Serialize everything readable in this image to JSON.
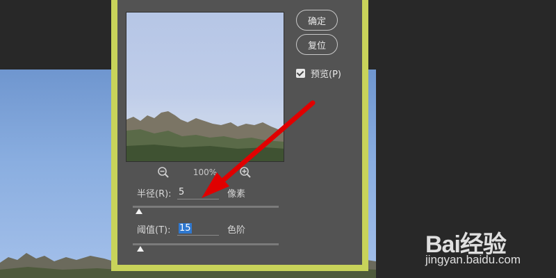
{
  "dialog": {
    "buttons": {
      "ok_label": "确定",
      "reset_label": "复位"
    },
    "preview_checkbox": {
      "label": "预览(P)",
      "checked": true
    },
    "zoom": {
      "level": "100%",
      "zoom_out_icon": "zoom-out-icon",
      "zoom_in_icon": "zoom-in-icon"
    },
    "radius": {
      "label": "半径(R):",
      "value": "5",
      "unit": "像素",
      "slider_fraction": 0.02
    },
    "threshold": {
      "label": "阈值(T):",
      "value": "15",
      "unit": "色阶",
      "slider_fraction": 0.03
    }
  },
  "watermark": {
    "brand": "Bai经验",
    "url": "jingyan.baidu.com"
  },
  "colors": {
    "dialog_border": "#c8d35a",
    "dialog_bg": "#535353",
    "annotation_arrow": "#e00000",
    "selection": "#2f78d0"
  }
}
